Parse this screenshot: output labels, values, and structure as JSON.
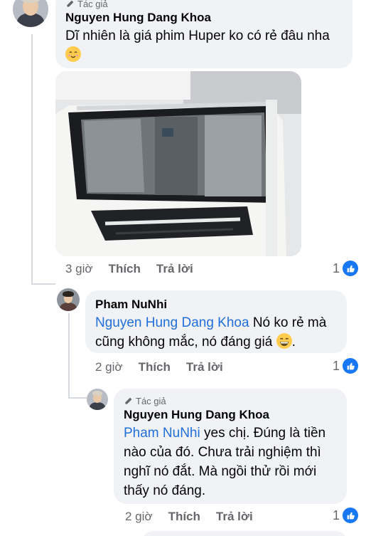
{
  "comments": [
    {
      "badge": "Tác giả",
      "author": "Nguyen Hung Dang Khoa",
      "text": "Dĩ nhiên là giá phim Huper ko có rẻ đâu nha",
      "emoji": "blushing-face",
      "time": "3 giờ",
      "like": "Thích",
      "reply": "Trả lời",
      "reactions": "1"
    },
    {
      "author": "Pham NuNhi",
      "mention": "Nguyen Hung Dang Khoa",
      "text": " Nó ko rẻ mà cũng không mắc, nó đáng giá ",
      "emoji": "grinning-face",
      "text_end": ".",
      "time": "2 giờ",
      "like": "Thích",
      "reply": "Trả lời",
      "reactions": "1"
    },
    {
      "badge": "Tác giả",
      "author": "Nguyen Hung Dang Khoa",
      "mention": "Pham NuNhi",
      "text": " yes chị. Đúng là tiền nào của đó. Chưa trải nghiệm thì nghĩ nó đắt. Mà ngồi thử rồi mới thấy nó đáng.",
      "time": "2 giờ",
      "like": "Thích",
      "reply": "Trả lời",
      "reactions": "1"
    }
  ],
  "colors": {
    "link": "#216fdb",
    "bubble": "#f0f2f5",
    "meta": "#65676b",
    "like": "#1877f2"
  }
}
